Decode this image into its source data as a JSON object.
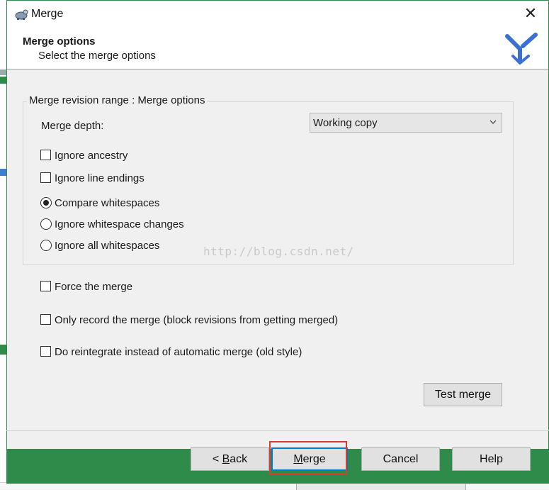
{
  "window": {
    "title": "Merge",
    "close_glyph": "✕"
  },
  "header": {
    "title": "Merge options",
    "subtitle": "Select the merge options"
  },
  "group": {
    "title": "Merge revision range : Merge options"
  },
  "depth": {
    "label": "Merge depth:",
    "selected": "Working copy"
  },
  "options": {
    "ignore_ancestry": {
      "label": "Ignore ancestry",
      "checked": false
    },
    "ignore_line_endings": {
      "label": "Ignore line endings",
      "checked": false
    }
  },
  "whitespace": {
    "compare": {
      "label": "Compare whitespaces",
      "selected": true
    },
    "ignore_changes": {
      "label": "Ignore whitespace changes",
      "selected": false
    },
    "ignore_all": {
      "label": "Ignore all whitespaces",
      "selected": false
    }
  },
  "extras": {
    "force": {
      "label": "Force the merge",
      "checked": false
    },
    "record_only": {
      "label": "Only record the merge (block revisions from getting merged)",
      "checked": false
    },
    "reintegrate": {
      "label": "Do reintegrate instead of automatic merge (old style)",
      "checked": false
    }
  },
  "buttons": {
    "test_merge": "Test merge",
    "back_prefix": "< ",
    "back_key": "B",
    "back_rest": "ack",
    "merge_key": "M",
    "merge_rest": "erge",
    "cancel": "Cancel",
    "help": "Help"
  },
  "watermark": "http://blog.csdn.net/",
  "colors": {
    "footer": "#2e8b4a",
    "highlight": "#e23b2e",
    "logo": "#3b6fd4"
  }
}
